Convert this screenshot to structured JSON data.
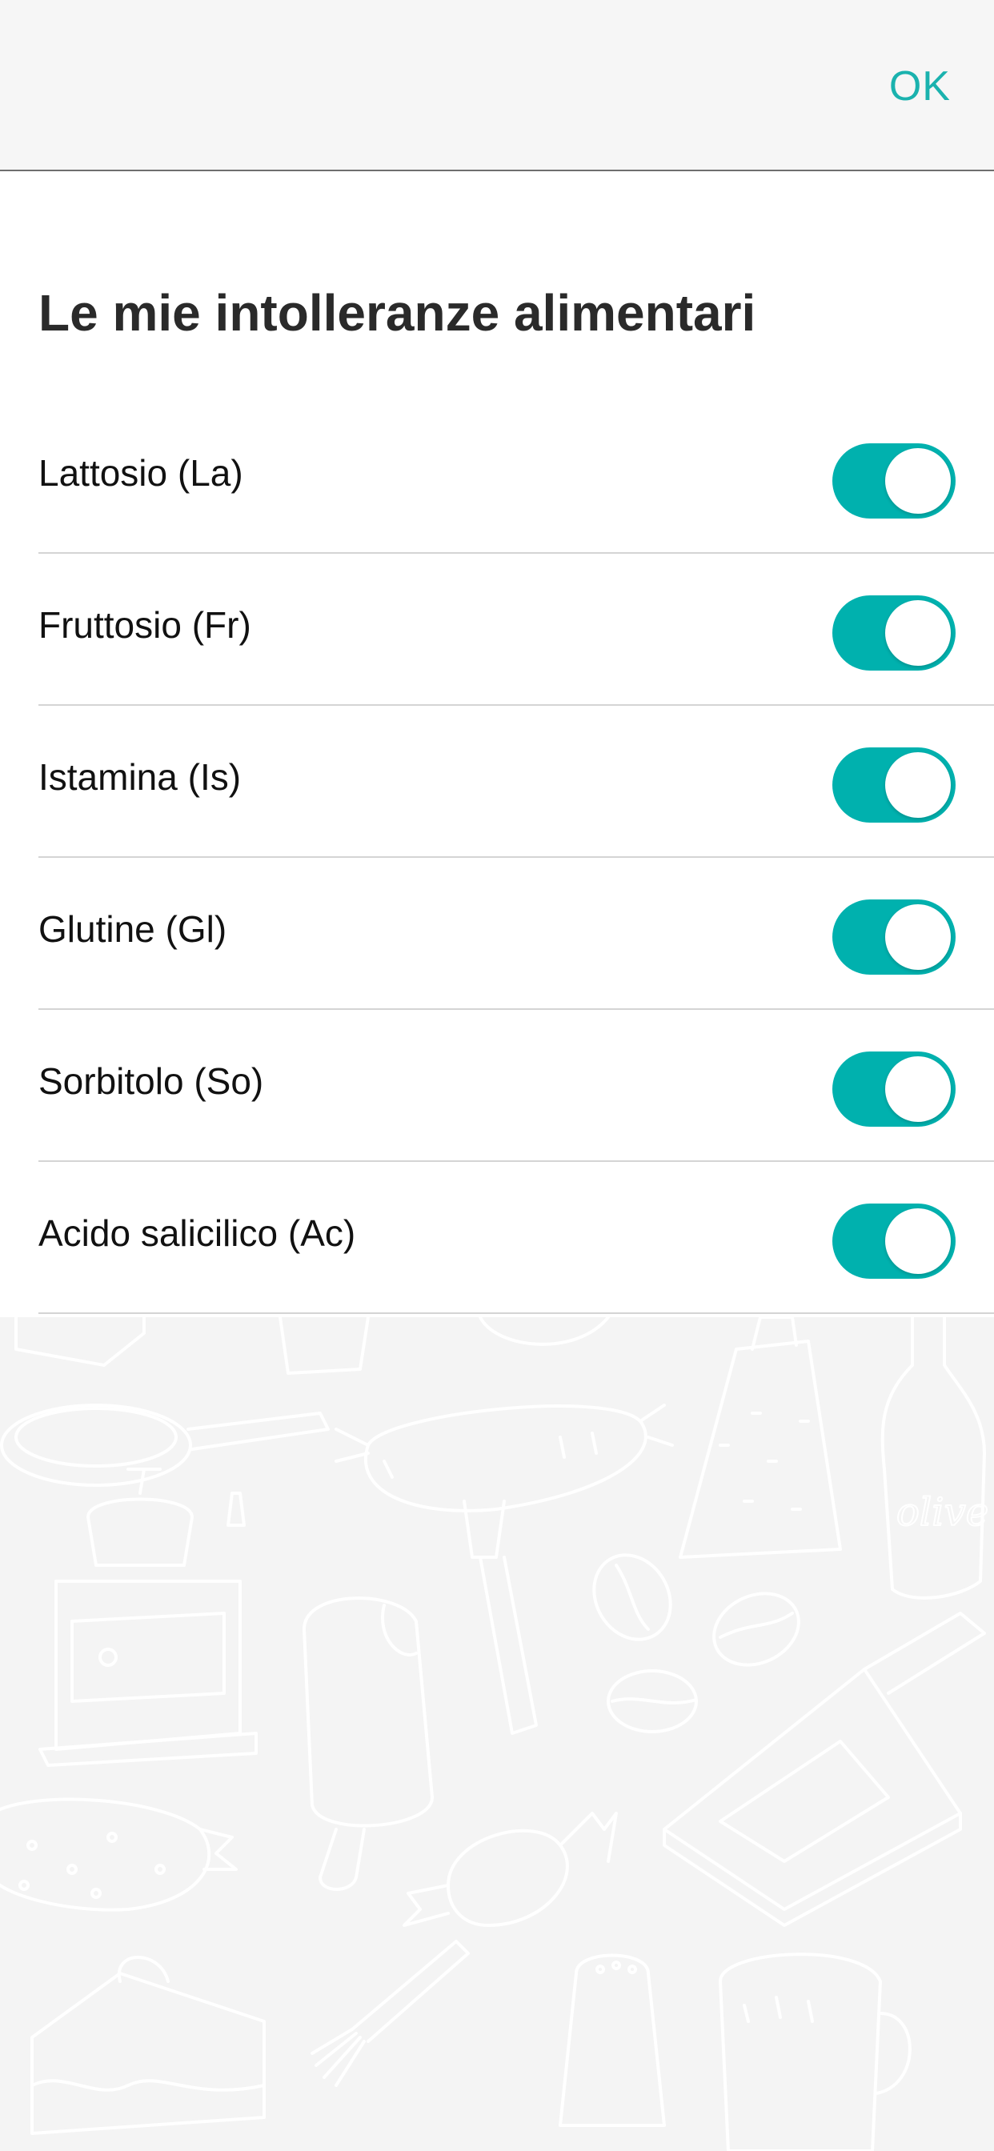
{
  "navbar": {
    "ok_label": "OK"
  },
  "page": {
    "title": "Le mie intolleranze alimentari"
  },
  "intolerances": [
    {
      "label": "Lattosio (La)",
      "enabled": true
    },
    {
      "label": "Fruttosio (Fr)",
      "enabled": true
    },
    {
      "label": "Istamina (Is)",
      "enabled": true
    },
    {
      "label": "Glutine (Gl)",
      "enabled": true
    },
    {
      "label": "Sorbitolo (So)",
      "enabled": true
    },
    {
      "label": "Acido salicilico (Ac)",
      "enabled": true
    }
  ],
  "background": {
    "doodle_text": "olive"
  },
  "colors": {
    "accent": "#00b1ae",
    "ok_text": "#1ab2ae",
    "title_text": "#2a2a2a",
    "page_background": "#f4f4f4"
  }
}
